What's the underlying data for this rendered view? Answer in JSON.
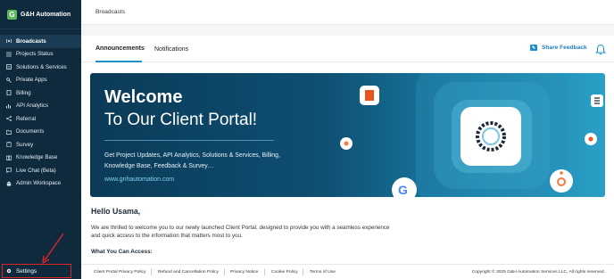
{
  "brand": {
    "logo_letter": "G",
    "name": "G&H Automation"
  },
  "sidebar": {
    "items": [
      {
        "label": "Broadcasts",
        "icon": "broadcast-icon"
      },
      {
        "label": "Projects Status",
        "icon": "list-icon"
      },
      {
        "label": "Solutions & Services",
        "icon": "services-icon"
      },
      {
        "label": "Private Apps",
        "icon": "key-icon"
      },
      {
        "label": "Billing",
        "icon": "billing-icon"
      },
      {
        "label": "API Analytics",
        "icon": "analytics-icon"
      },
      {
        "label": "Referral",
        "icon": "share-icon"
      },
      {
        "label": "Documents",
        "icon": "folder-icon"
      },
      {
        "label": "Survey",
        "icon": "clipboard-icon"
      },
      {
        "label": "Knowledge Base",
        "icon": "book-icon"
      },
      {
        "label": "Live Chat (Beta)",
        "icon": "chat-icon"
      },
      {
        "label": "Admin Workspace",
        "icon": "workspace-icon"
      }
    ],
    "settings_label": "Settings"
  },
  "breadcrumb": "Broadcasts",
  "tabs": [
    {
      "label": "Announcements"
    },
    {
      "label": "Notifications"
    }
  ],
  "share_feedback_label": "Share Feedback",
  "banner": {
    "title": "Welcome",
    "subtitle": "To Our Client Portal!",
    "description": "Get Project Updates, API Analytics, Solutions & Services, Billing, Knowledge Base, Feedback & Survey…",
    "link": "www.gnhautomation.com"
  },
  "greeting": "Hello Usama,",
  "intro": "We are thrilled to welcome you to our newly launched Client Portal, designed to provide you with a seamless experience and quick access to the information that matters most to you.",
  "what_heading": "What You Can Access:",
  "footer": {
    "links": [
      "Client Portal Privacy Policy",
      "Refund and Cancellation Policy",
      "Privacy Notice",
      "Cookie Policy",
      "Terms of Use"
    ],
    "copyright": "Copyright © 2025 G&H Automation Services LLC, All rights reserved."
  },
  "colors": {
    "sidebar_bg": "#0f2a3d",
    "accent": "#1e8fc6",
    "highlight_box": "#e02424"
  }
}
